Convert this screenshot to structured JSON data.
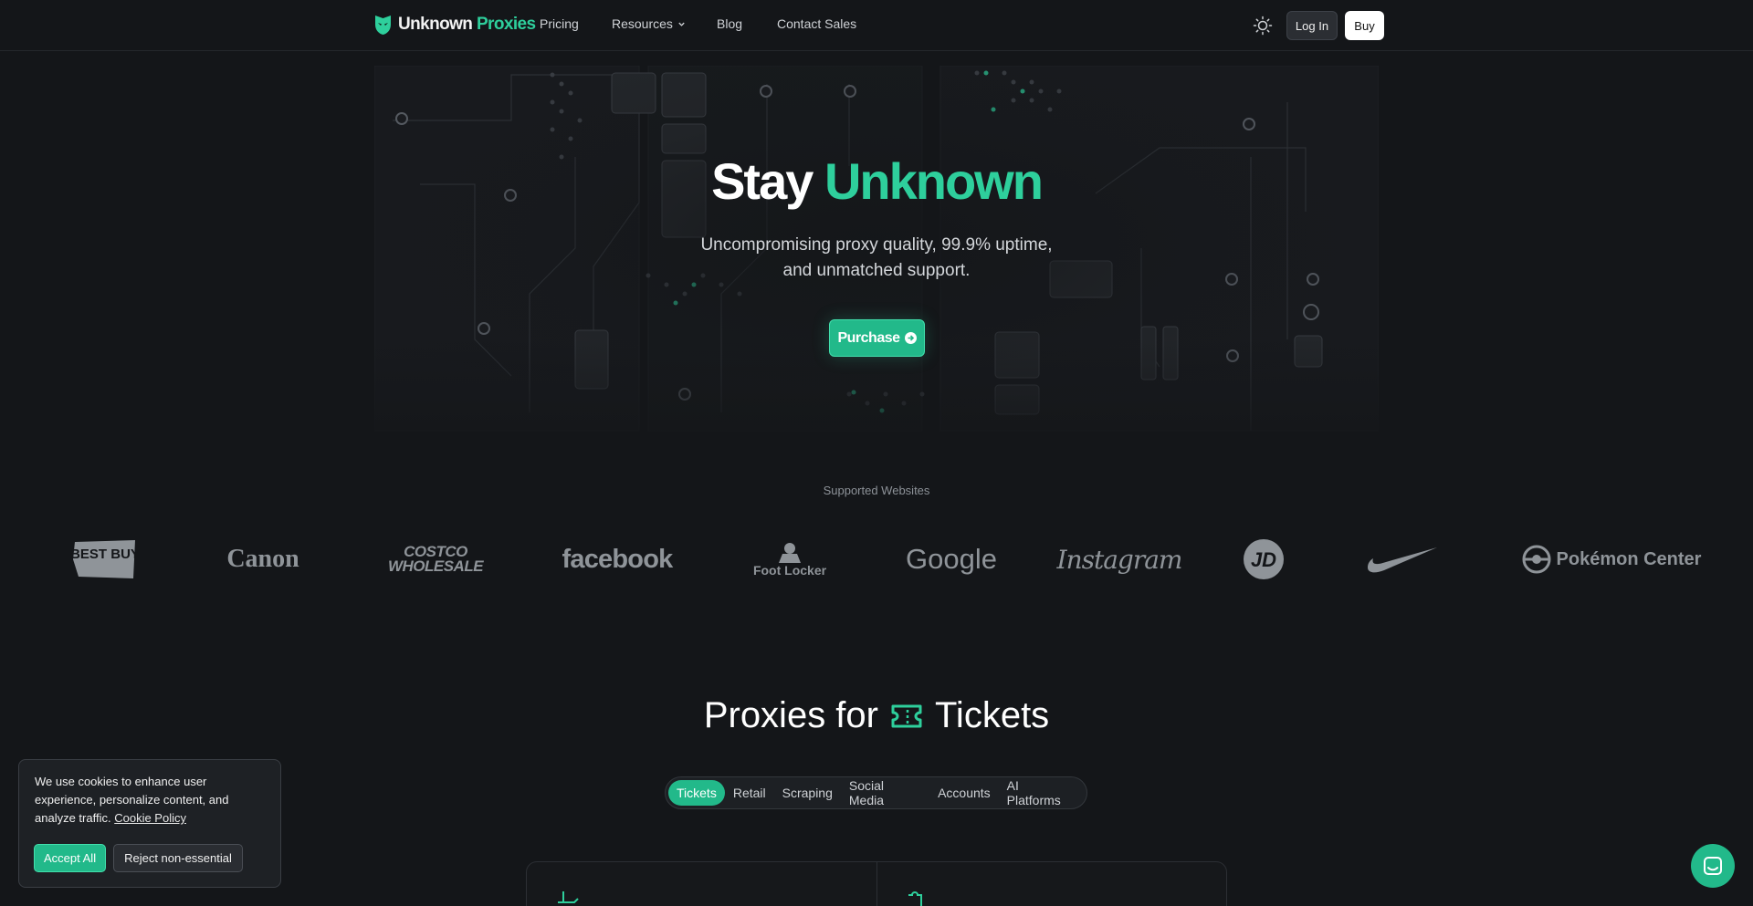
{
  "nav": {
    "brand_part1": "Unknown",
    "brand_part2": "Proxies",
    "links": [
      "Pricing",
      "Resources",
      "Blog",
      "Contact Sales"
    ],
    "login_label": "Log In",
    "buy_label": "Buy"
  },
  "hero": {
    "title_part1": "Stay",
    "title_part2": "Unknown",
    "subtitle_line1": "Uncompromising proxy quality, 99.9% uptime,",
    "subtitle_line2": "and unmatched support.",
    "cta_label": "Purchase"
  },
  "supported": {
    "label": "Supported Websites",
    "logos": [
      "BEST BUY",
      "Canon",
      "COSTCO WHOLESALE",
      "facebook",
      "Foot Locker",
      "Google",
      "Instagram",
      "JD",
      "Nike",
      "Pokémon Center"
    ]
  },
  "section": {
    "title_part1": "Proxies for",
    "title_part2": "Tickets",
    "tabs": [
      "Tickets",
      "Retail",
      "Scraping",
      "Social Media",
      "Accounts",
      "AI Platforms"
    ],
    "active_tab": "Tickets"
  },
  "cookie": {
    "text": "We use cookies to enhance user experience, personalize content, and analyze traffic.",
    "link": "Cookie Policy",
    "accept_label": "Accept All",
    "reject_label": "Reject non-essential"
  },
  "colors": {
    "accent": "#2ecf9c",
    "background": "#141619"
  },
  "icons": [
    "logo-mask-icon",
    "chevron-down-icon",
    "sun-icon",
    "arrow-right-circle-icon",
    "ticket-icon",
    "chat-icon"
  ]
}
